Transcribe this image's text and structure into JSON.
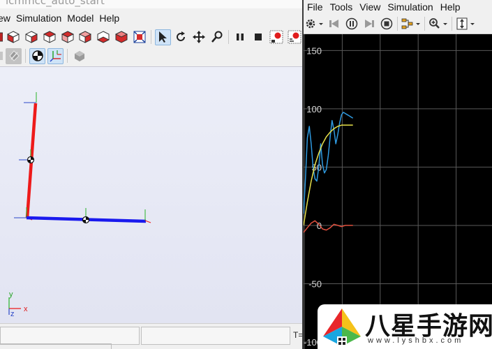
{
  "left_window": {
    "title": "lcmmcc_auto_start",
    "menu": [
      "ew",
      "Simulation",
      "Model",
      "Help"
    ],
    "toolbar_icons": [
      "view-front-icon",
      "view-back-icon",
      "view-left-icon",
      "view-right-icon",
      "view-top-icon",
      "view-bottom-icon",
      "view-iso-icon",
      "fit-to-view-icon",
      "select-cursor-icon",
      "rotate-icon",
      "pan-icon",
      "zoom-icon",
      "pause-icon",
      "stop-icon",
      "record-icon",
      "record-settings-icon"
    ],
    "toolbar2_icons": [
      "frame-icon",
      "convex-hull-icon",
      "center-of-mass-icon",
      "coordinate-frames-icon",
      "save-view-icon"
    ],
    "triad": {
      "y_label": "y",
      "z_label": "z",
      "x_label": "x"
    },
    "status": {
      "time_label": "T="
    }
  },
  "right_window": {
    "menu": [
      "File",
      "Tools",
      "View",
      "Simulation",
      "Help"
    ],
    "toolbar_icons": [
      "settings-gear-icon",
      "step-back-icon",
      "run-icon",
      "step-forward-icon",
      "stop-icon",
      "layout-icon",
      "zoom-in-icon",
      "autoscale-icon"
    ]
  },
  "chart_data": {
    "type": "line",
    "title": "",
    "xlabel": "",
    "ylabel": "",
    "y_ticks": [
      "150",
      "100",
      "50",
      "0",
      "-50",
      "-100"
    ],
    "y_tick_values": [
      150,
      100,
      50,
      0,
      -50,
      -100
    ],
    "ylim": [
      -106,
      164
    ],
    "xlim": [
      0,
      10
    ],
    "grid": true,
    "series": [
      {
        "color": "#2f9ae0",
        "x": [
          0,
          0.1,
          0.2,
          0.3,
          0.4,
          0.5,
          0.6,
          0.7,
          0.8,
          0.9,
          1.0,
          1.1,
          1.2,
          1.3,
          1.4,
          1.5,
          1.6,
          1.7,
          1.8,
          1.9,
          2.0,
          2.1,
          2.2,
          2.3,
          2.4,
          2.5,
          2.6
        ],
        "y": [
          10,
          40,
          75,
          85,
          70,
          50,
          40,
          38,
          50,
          70,
          52,
          45,
          48,
          60,
          76,
          90,
          82,
          70,
          78,
          88,
          95,
          97,
          96,
          95,
          94,
          93,
          92
        ]
      },
      {
        "color": "#e6e04a",
        "x": [
          0,
          0.2,
          0.4,
          0.6,
          0.8,
          1.0,
          1.2,
          1.4,
          1.6,
          1.8,
          2.0,
          2.2,
          2.4,
          2.6
        ],
        "y": [
          0,
          20,
          38,
          52,
          62,
          70,
          76,
          80,
          83,
          85,
          86,
          86,
          86,
          86
        ]
      },
      {
        "color": "#e0503e",
        "x": [
          0,
          0.2,
          0.4,
          0.6,
          0.8,
          1.0,
          1.2,
          1.4,
          1.6,
          1.8,
          2.0,
          2.2,
          2.4,
          2.6
        ],
        "y": [
          -6,
          -2,
          2,
          4,
          1,
          -3,
          -4,
          -2,
          1,
          0,
          -1,
          0,
          0,
          0
        ]
      }
    ]
  },
  "watermark": {
    "title": "八星手游网",
    "url": "www.lyshbx.com"
  }
}
